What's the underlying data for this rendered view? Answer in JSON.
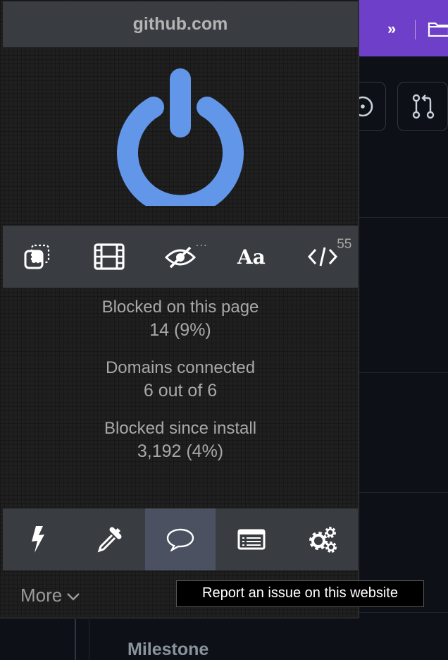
{
  "background": {
    "chevrons": "»",
    "milestone_label": "Milestone"
  },
  "popup": {
    "hostname": "github.com",
    "power_icon": "power-icon",
    "top_tools": [
      {
        "name": "element-zapper-icon"
      },
      {
        "name": "media-block-icon"
      },
      {
        "name": "cosmetic-filter-icon",
        "badge": "..."
      },
      {
        "name": "remote-fonts-icon",
        "text": "Aa"
      },
      {
        "name": "javascript-icon",
        "badge": "55"
      }
    ],
    "stats": [
      {
        "label": "Blocked on this page",
        "value": "14 (9%)"
      },
      {
        "label": "Domains connected",
        "value": "6 out of 6"
      },
      {
        "label": "Blocked since install",
        "value": "3,192 (4%)"
      }
    ],
    "bottom_tools": [
      {
        "name": "lightning-icon"
      },
      {
        "name": "eyedropper-icon"
      },
      {
        "name": "speech-bubble-icon"
      },
      {
        "name": "logger-icon"
      },
      {
        "name": "settings-gears-icon"
      }
    ],
    "more_label": "More",
    "tooltip": "Report an issue on this website"
  },
  "colors": {
    "accent": "#6296e9",
    "header_purple": "#6e40c9",
    "panel": "#393c41",
    "active_tool": "#4b5160"
  }
}
